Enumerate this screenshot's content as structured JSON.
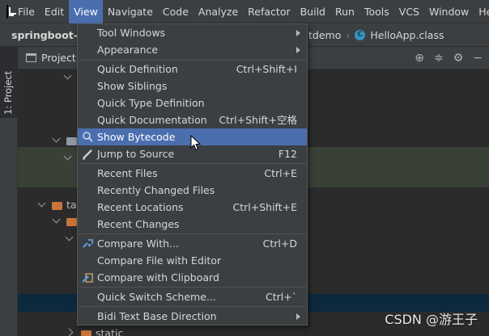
{
  "menubar": {
    "items": [
      "File",
      "Edit",
      "View",
      "Navigate",
      "Code",
      "Analyze",
      "Refactor",
      "Build",
      "Run",
      "Tools",
      "VCS",
      "Window",
      "Help"
    ],
    "active_index": 2
  },
  "navbar": {
    "project": "springboot-de",
    "crumb_1": "tdemo",
    "crumb_2": "HelloApp.class",
    "class_icon_letter": "C"
  },
  "toolwindow": {
    "side_label": "1: Project",
    "title": "Project",
    "tree_label_1": "ta",
    "tree_label_2": "static"
  },
  "view_menu": {
    "items": [
      {
        "label": "Tool Windows",
        "shortcut": "",
        "submenu": true,
        "icon": ""
      },
      {
        "label": "Appearance",
        "shortcut": "",
        "submenu": true,
        "icon": ""
      },
      {
        "label": "Quick Definition",
        "shortcut": "Ctrl+Shift+I",
        "submenu": false,
        "icon": ""
      },
      {
        "label": "Show Siblings",
        "shortcut": "",
        "submenu": false,
        "icon": ""
      },
      {
        "label": "Quick Type Definition",
        "shortcut": "",
        "submenu": false,
        "icon": ""
      },
      {
        "label": "Quick Documentation",
        "shortcut": "Ctrl+Shift+空格",
        "submenu": false,
        "icon": ""
      },
      {
        "label": "Show Bytecode",
        "shortcut": "",
        "submenu": false,
        "icon": "bytecode-search-icon"
      },
      {
        "label": "Jump to Source",
        "shortcut": "F12",
        "submenu": false,
        "icon": "edit-pencil-icon"
      },
      {
        "label": "Recent Files",
        "shortcut": "Ctrl+E",
        "submenu": false,
        "icon": ""
      },
      {
        "label": "Recently Changed Files",
        "shortcut": "",
        "submenu": false,
        "icon": ""
      },
      {
        "label": "Recent Locations",
        "shortcut": "Ctrl+Shift+E",
        "submenu": false,
        "icon": ""
      },
      {
        "label": "Recent Changes",
        "shortcut": "",
        "submenu": false,
        "icon": ""
      },
      {
        "label": "Compare With...",
        "shortcut": "Ctrl+D",
        "submenu": false,
        "icon": "compare-icon"
      },
      {
        "label": "Compare File with Editor",
        "shortcut": "",
        "submenu": false,
        "icon": ""
      },
      {
        "label": "Compare with Clipboard",
        "shortcut": "",
        "submenu": false,
        "icon": "clipboard-compare-icon"
      },
      {
        "label": "Quick Switch Scheme...",
        "shortcut": "Ctrl+`",
        "submenu": false,
        "icon": ""
      },
      {
        "label": "Bidi Text Base Direction",
        "shortcut": "",
        "submenu": true,
        "icon": ""
      }
    ],
    "highlighted_index": 6
  },
  "watermark": "CSDN @游王子",
  "colors": {
    "menu_bg": "#3c3f41",
    "highlight": "#4b6eaf",
    "editor_bg": "#2b2b2b",
    "folder_orange": "#c8743a"
  }
}
